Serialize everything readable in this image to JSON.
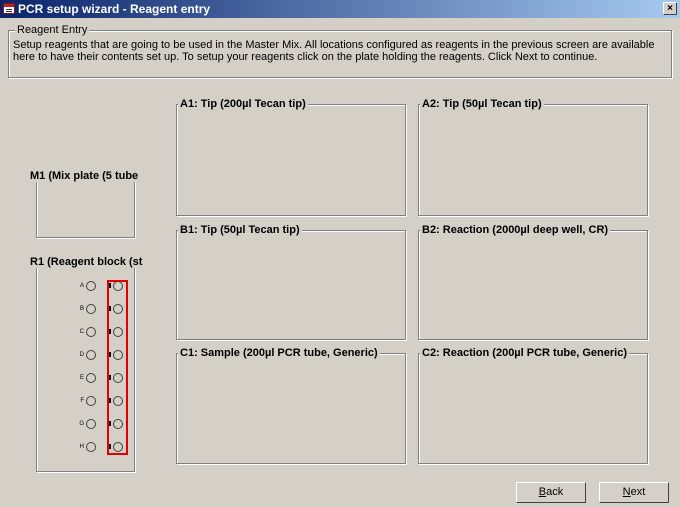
{
  "window": {
    "title": "PCR setup wizard - Reagent entry",
    "close_label": "×"
  },
  "reagent_entry": {
    "legend": "Reagent Entry",
    "description": "Setup reagents that are going to be used in the Master Mix. All locations configured as reagents in the previous screen are available here to have their contents set up. To setup your reagents click on the plate holding the reagents. Click Next to continue."
  },
  "positions": {
    "a1": "A1: Tip (200µl Tecan tip)",
    "a2": "A2: Tip (50µl Tecan tip)",
    "b1": "B1: Tip (50µl Tecan tip)",
    "b2": "B2: Reaction (2000µl deep well, CR)",
    "c1": "C1: Sample (200µl PCR tube, Generic)",
    "c2": "C2: Reaction (200µl PCR tube, Generic)",
    "m1": "M1 (Mix plate (5 tube",
    "r1": "R1 (Reagent block (st"
  },
  "reagent_block": {
    "rows": [
      "A",
      "B",
      "C",
      "D",
      "E",
      "F",
      "G",
      "H"
    ]
  },
  "buttons": {
    "back": "Back",
    "back_key": "B",
    "back_rest": "ack",
    "next": "Next",
    "next_key": "N",
    "next_rest": "ext"
  }
}
